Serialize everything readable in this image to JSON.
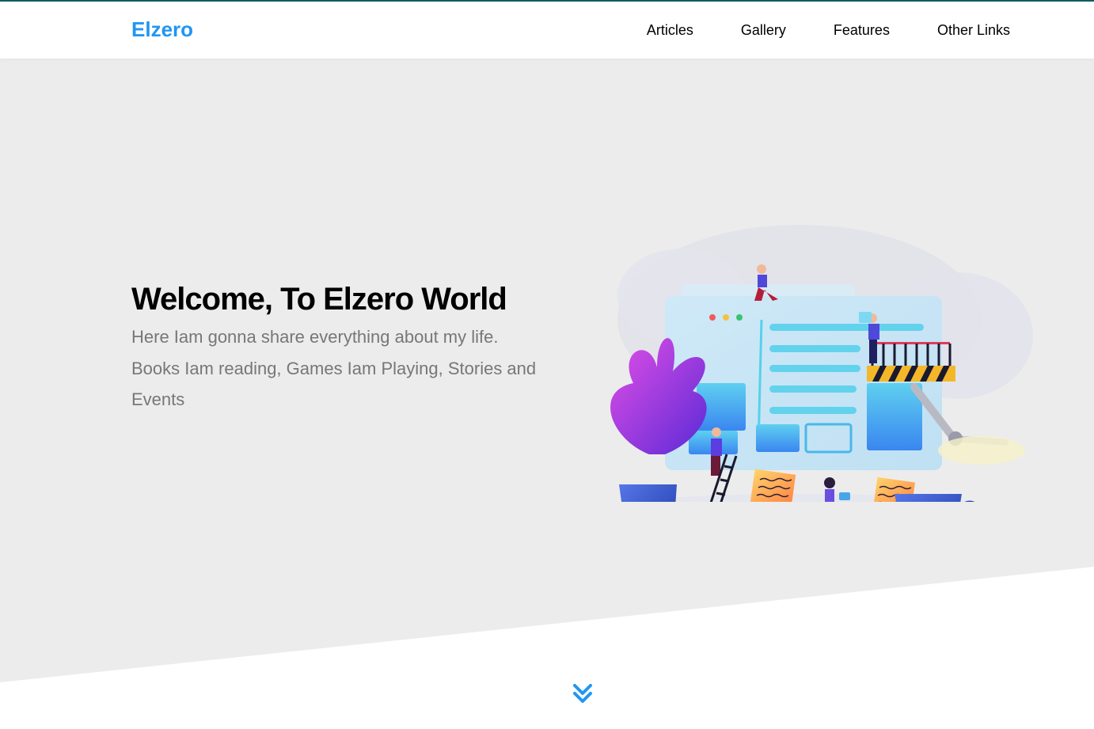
{
  "header": {
    "logo": "Elzero",
    "nav": [
      "Articles",
      "Gallery",
      "Features",
      "Other Links"
    ]
  },
  "hero": {
    "title": "Welcome, To Elzero World",
    "description": "Here Iam gonna share everything about my life. Books Iam reading, Games Iam Playing, Stories and Events"
  },
  "colors": {
    "accent": "#2196f3",
    "hero_bg": "#ececec",
    "top_border": "#0f5f63"
  },
  "icons": {
    "scroll_down": "double-chevron-down-icon",
    "illustration": "web-development-illustration"
  }
}
